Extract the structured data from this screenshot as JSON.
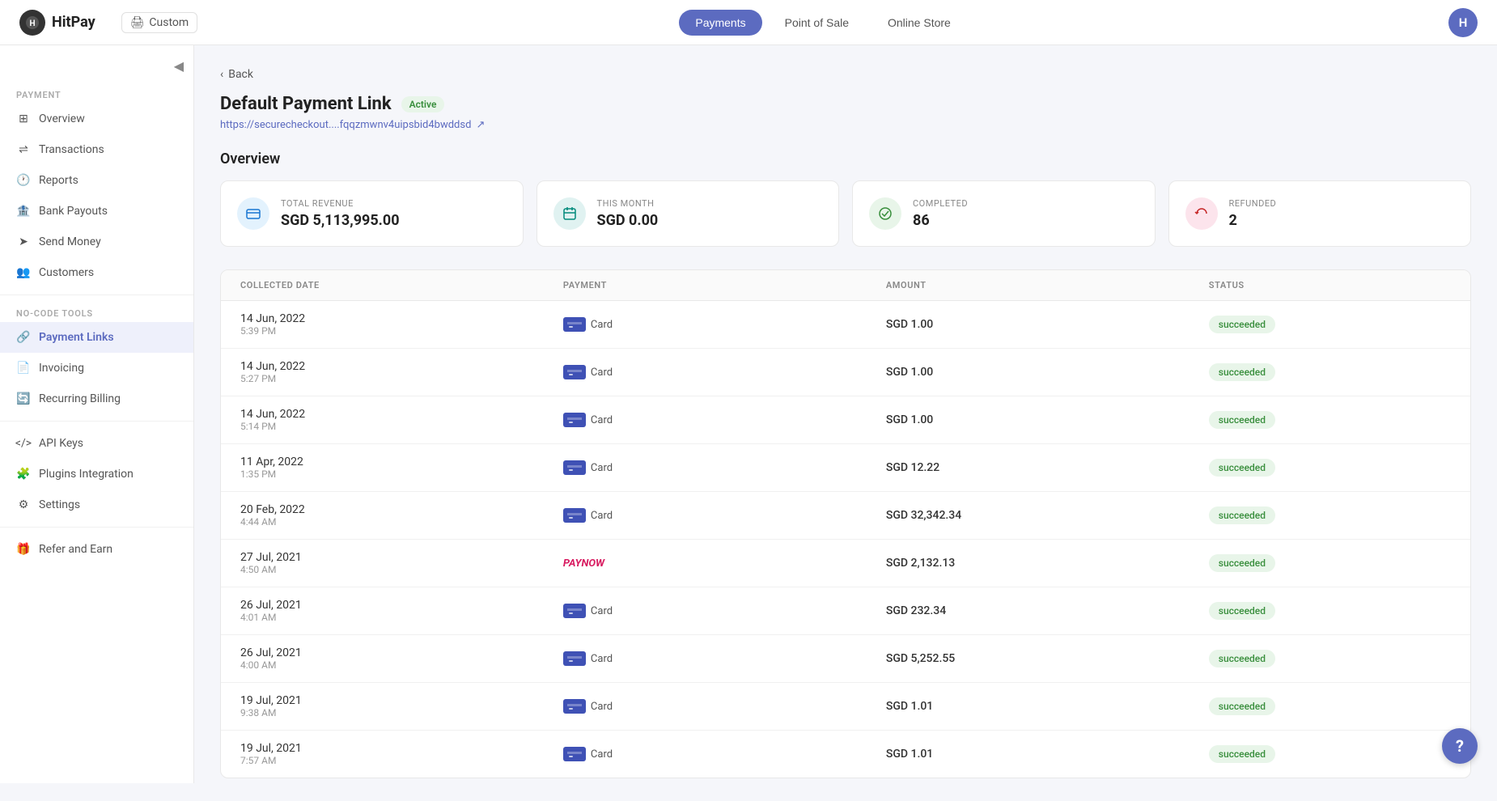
{
  "topnav": {
    "logo_text": "HitPay",
    "logo_initial": "H",
    "custom_label": "Custom",
    "nav_items": [
      {
        "id": "payments",
        "label": "Payments",
        "active": true
      },
      {
        "id": "pos",
        "label": "Point of Sale",
        "active": false
      },
      {
        "id": "online-store",
        "label": "Online Store",
        "active": false
      }
    ],
    "avatar_initial": "H"
  },
  "sidebar": {
    "collapse_icon": "◀",
    "sections": [
      {
        "label": "PAYMENT",
        "items": [
          {
            "id": "overview",
            "label": "Overview",
            "icon": "grid"
          },
          {
            "id": "transactions",
            "label": "Transactions",
            "icon": "arrow-right-left"
          },
          {
            "id": "reports",
            "label": "Reports",
            "icon": "clock"
          },
          {
            "id": "bank-payouts",
            "label": "Bank Payouts",
            "icon": "bank"
          },
          {
            "id": "send-money",
            "label": "Send Money",
            "icon": "send"
          },
          {
            "id": "customers",
            "label": "Customers",
            "icon": "users"
          }
        ]
      },
      {
        "label": "NO-CODE TOOLS",
        "items": [
          {
            "id": "payment-links",
            "label": "Payment Links",
            "icon": "link",
            "active": true
          },
          {
            "id": "invoicing",
            "label": "Invoicing",
            "icon": "file"
          },
          {
            "id": "recurring-billing",
            "label": "Recurring Billing",
            "icon": "repeat"
          }
        ]
      },
      {
        "label": "",
        "items": [
          {
            "id": "api-keys",
            "label": "API Keys",
            "icon": "code"
          },
          {
            "id": "plugins",
            "label": "Plugins Integration",
            "icon": "puzzle"
          },
          {
            "id": "settings",
            "label": "Settings",
            "icon": "gear"
          },
          {
            "id": "refer-earn",
            "label": "Refer and Earn",
            "icon": "gift"
          }
        ]
      }
    ]
  },
  "back_label": "Back",
  "page": {
    "title": "Default Payment Link",
    "status": "Active",
    "url": "https://securecheckout....fqqzmwnv4uipsbid4bwddsd",
    "overview_title": "Overview"
  },
  "stats": [
    {
      "id": "total-revenue",
      "label": "TOTAL REVENUE",
      "value": "SGD 5,113,995.00",
      "icon_type": "blue",
      "icon": "💳"
    },
    {
      "id": "this-month",
      "label": "THIS MONTH",
      "value": "SGD 0.00",
      "icon_type": "teal",
      "icon": "📅"
    },
    {
      "id": "completed",
      "label": "COMPLETED",
      "value": "86",
      "icon_type": "green",
      "icon": "✓"
    },
    {
      "id": "refunded",
      "label": "REFUNDED",
      "value": "2",
      "icon_type": "red",
      "icon": "↩"
    }
  ],
  "table": {
    "headers": [
      "COLLECTED DATE",
      "PAYMENT",
      "AMOUNT",
      "STATUS"
    ],
    "rows": [
      {
        "date": "14 Jun, 2022",
        "time": "5:39 PM",
        "payment": "Card",
        "payment_type": "card",
        "amount": "SGD 1.00",
        "status": "succeeded"
      },
      {
        "date": "14 Jun, 2022",
        "time": "5:27 PM",
        "payment": "Card",
        "payment_type": "card",
        "amount": "SGD 1.00",
        "status": "succeeded"
      },
      {
        "date": "14 Jun, 2022",
        "time": "5:14 PM",
        "payment": "Card",
        "payment_type": "card",
        "amount": "SGD 1.00",
        "status": "succeeded"
      },
      {
        "date": "11 Apr, 2022",
        "time": "1:35 PM",
        "payment": "Card",
        "payment_type": "card",
        "amount": "SGD 12.22",
        "status": "succeeded"
      },
      {
        "date": "20 Feb, 2022",
        "time": "4:44 AM",
        "payment": "Card",
        "payment_type": "card",
        "amount": "SGD 32,342.34",
        "status": "succeeded"
      },
      {
        "date": "27 Jul, 2021",
        "time": "4:50 AM",
        "payment": "PayNow",
        "payment_type": "paynow",
        "amount": "SGD 2,132.13",
        "status": "succeeded"
      },
      {
        "date": "26 Jul, 2021",
        "time": "4:01 AM",
        "payment": "Card",
        "payment_type": "card",
        "amount": "SGD 232.34",
        "status": "succeeded"
      },
      {
        "date": "26 Jul, 2021",
        "time": "4:00 AM",
        "payment": "Card",
        "payment_type": "card",
        "amount": "SGD 5,252.55",
        "status": "succeeded"
      },
      {
        "date": "19 Jul, 2021",
        "time": "9:38 AM",
        "payment": "Card",
        "payment_type": "card",
        "amount": "SGD 1.01",
        "status": "succeeded"
      },
      {
        "date": "19 Jul, 2021",
        "time": "7:57 AM",
        "payment": "Card",
        "payment_type": "card",
        "amount": "SGD 1.01",
        "status": "succeeded"
      }
    ],
    "status_succeeded_label": "succeeded"
  },
  "help_label": "?"
}
